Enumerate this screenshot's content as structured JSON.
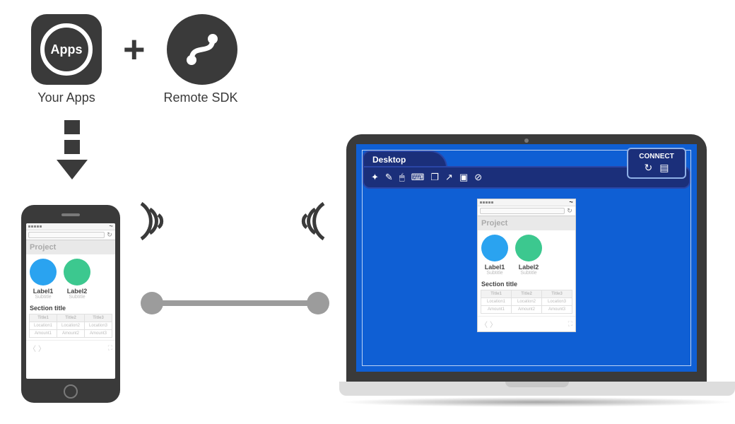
{
  "top": {
    "apps_badge_text": "Apps",
    "your_apps_label": "Your Apps",
    "sdk_label": "Remote SDK"
  },
  "phone_app": {
    "project_title": "Project",
    "label1": "Label1",
    "label2": "Label2",
    "subtitle": "Subtitle",
    "section_title": "Section title",
    "headers": [
      "Title1",
      "Title2",
      "Title3"
    ],
    "row1": [
      "Location1",
      "Location2",
      "Location3"
    ],
    "row2": [
      "Amount1",
      "Amount2",
      "Amount3"
    ]
  },
  "desktop": {
    "tab_label": "Desktop",
    "connect_label": "CONNECT"
  }
}
